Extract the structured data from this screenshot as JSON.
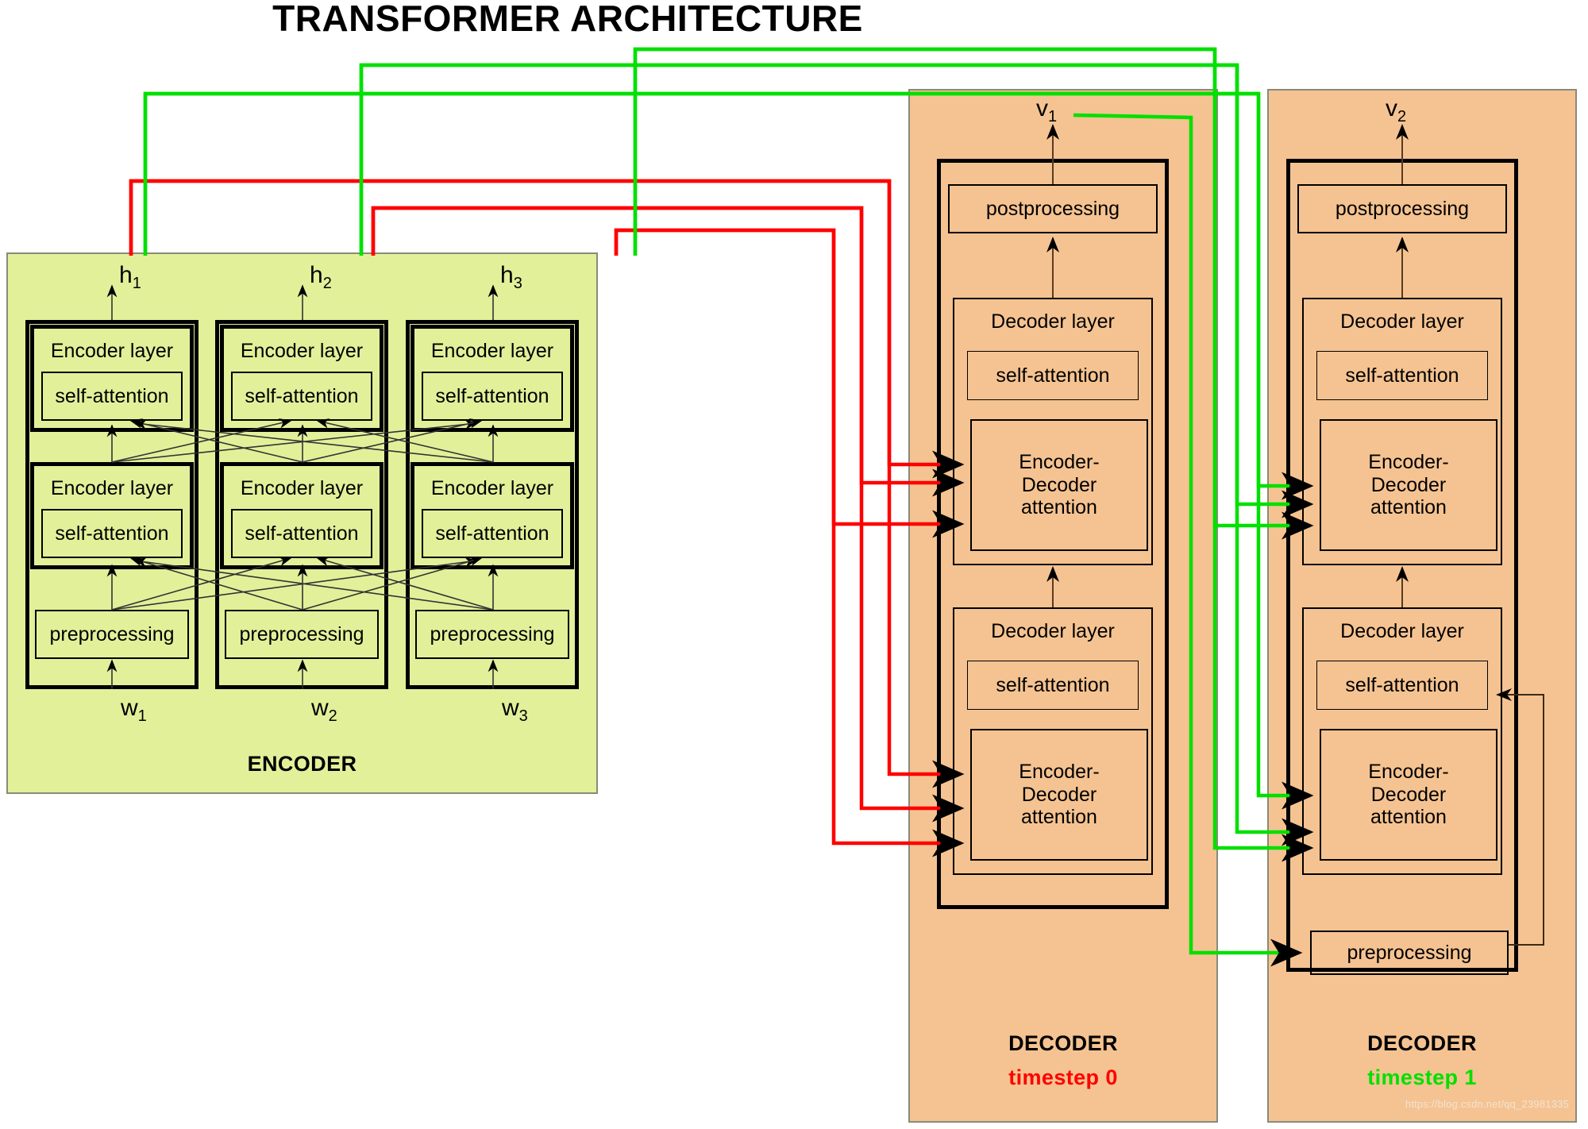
{
  "title": "TRANSFORMER ARCHITECTURE",
  "colors": {
    "encoder_bg": "#e2f09a",
    "decoder_bg": "#f5c391",
    "timestep0_accent": "#ff0000",
    "timestep1_accent": "#00e000",
    "outline": "#000000"
  },
  "encoder": {
    "caption": "ENCODER",
    "output_labels": [
      "h",
      "h",
      "h"
    ],
    "output_subs": [
      "1",
      "2",
      "3"
    ],
    "input_labels": [
      "w",
      "w",
      "w"
    ],
    "input_subs": [
      "1",
      "2",
      "3"
    ],
    "columns": [
      {
        "layers": [
          {
            "name": "Encoder layer",
            "inner": "self-attention"
          },
          {
            "name": "Encoder layer",
            "inner": "self-attention"
          }
        ],
        "preprocessing": "preprocessing"
      },
      {
        "layers": [
          {
            "name": "Encoder layer",
            "inner": "self-attention"
          },
          {
            "name": "Encoder layer",
            "inner": "self-attention"
          }
        ],
        "preprocessing": "preprocessing"
      },
      {
        "layers": [
          {
            "name": "Encoder layer",
            "inner": "self-attention"
          },
          {
            "name": "Encoder layer",
            "inner": "self-attention"
          }
        ],
        "preprocessing": "preprocessing"
      }
    ]
  },
  "decoders": [
    {
      "caption": "DECODER",
      "timestep": "timestep 0",
      "timestep_color": "#ff0000",
      "output_label": "v",
      "output_sub": "1",
      "postprocessing": "postprocessing",
      "layers": [
        {
          "name": "Decoder layer",
          "self_attention": "self-attention",
          "cross_attention": "Encoder-\nDecoder\nattention"
        },
        {
          "name": "Decoder layer",
          "self_attention": "self-attention",
          "cross_attention": "Encoder-\nDecoder\nattention"
        }
      ],
      "preprocessing": null
    },
    {
      "caption": "DECODER",
      "timestep": "timestep 1",
      "timestep_color": "#00e000",
      "output_label": "v",
      "output_sub": "2",
      "postprocessing": "postprocessing",
      "layers": [
        {
          "name": "Decoder layer",
          "self_attention": "self-attention",
          "cross_attention": "Encoder-\nDecoder\nattention"
        },
        {
          "name": "Decoder layer",
          "self_attention": "self-attention",
          "cross_attention": "Encoder-\nDecoder\nattention"
        }
      ],
      "preprocessing": "preprocessing"
    }
  ],
  "decoder_layer_text": {
    "cross_line1": "Encoder-",
    "cross_line2": "Decoder",
    "cross_line3": "attention"
  },
  "watermark": "https://blog.csdn.net/qq_23981335"
}
